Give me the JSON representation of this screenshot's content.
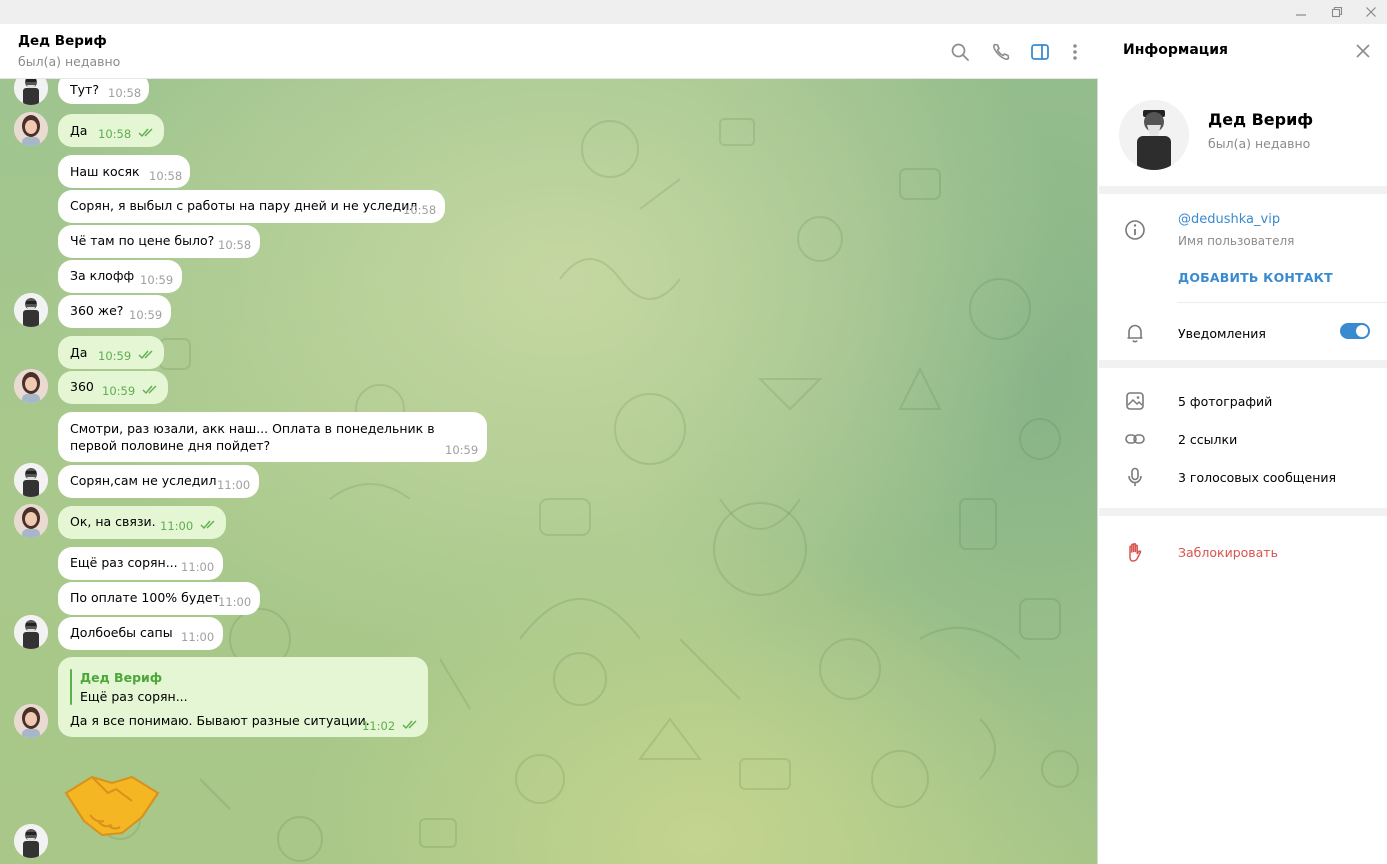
{
  "header": {
    "title": "Дед Вериф",
    "status": "был(а) недавно"
  },
  "messages": [
    {
      "side": "in",
      "text": "Тут?",
      "time": "10:58"
    },
    {
      "side": "out",
      "text": "Да",
      "time": "10:58"
    },
    {
      "side": "in",
      "text": "Наш косяк",
      "time": "10:58"
    },
    {
      "side": "in",
      "text": "Сорян, я выбыл с работы на пару дней и не уследил",
      "time": "10:58"
    },
    {
      "side": "in",
      "text": "Чё там по цене было?",
      "time": "10:58"
    },
    {
      "side": "in",
      "text": "За клофф",
      "time": "10:59"
    },
    {
      "side": "in",
      "text": "360 же?",
      "time": "10:59"
    },
    {
      "side": "out",
      "text": "Да",
      "time": "10:59"
    },
    {
      "side": "out",
      "text": "360",
      "time": "10:59"
    },
    {
      "side": "in",
      "text": "Смотри, раз юзали, акк наш... Оплата в понедельник в первой половине дня пойдет?",
      "time": "10:59"
    },
    {
      "side": "in",
      "text": "Сорян,сам не уследил",
      "time": "11:00"
    },
    {
      "side": "out",
      "text": "Ок, на связи.",
      "time": "11:00"
    },
    {
      "side": "in",
      "text": "Ещё раз сорян...",
      "time": "11:00"
    },
    {
      "side": "in",
      "text": "По оплате 100% будет",
      "time": "11:00"
    },
    {
      "side": "in",
      "text": "Долбоебы сапы",
      "time": "11:00"
    },
    {
      "side": "out",
      "reply_name": "Дед Вериф",
      "reply_text": "Ещё раз сорян...",
      "text": "Да я все понимаю. Бывают разные ситуации.",
      "time": "11:02"
    }
  ],
  "sticker": "handshake",
  "info": {
    "title": "Информация",
    "name": "Дед Вериф",
    "status": "был(а) недавно",
    "username": "@dedushka_vip",
    "username_label": "Имя пользователя",
    "add_contact": "ДОБАВИТЬ КОНТАКТ",
    "notifications": "Уведомления",
    "notifications_on": true,
    "photos": "5 фотографий",
    "links": "2 ссылки",
    "voices": "3 голосовых сообщения",
    "block": "Заблокировать"
  },
  "icons": [
    "minimize-icon",
    "restore-icon",
    "close-icon",
    "search-icon",
    "phone-icon",
    "sidebar-toggle-icon",
    "more-icon",
    "info-icon",
    "bell-icon",
    "photo-icon",
    "link-icon",
    "microphone-icon",
    "block-hand-icon"
  ],
  "colors": {
    "accent": "#3a8ad0",
    "outgoing_bubble": "#e4f6d3",
    "check": "#5fae4f",
    "danger": "#d9534f"
  }
}
